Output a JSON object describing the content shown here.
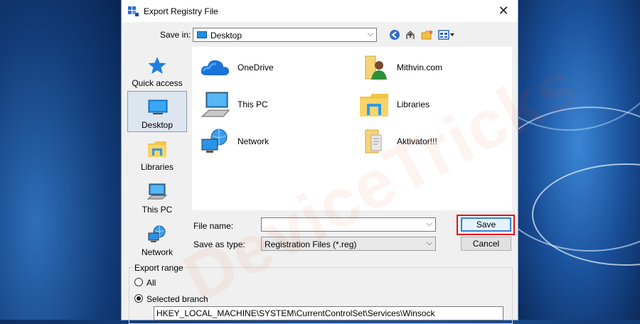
{
  "dialog": {
    "title": "Export Registry File",
    "close_glyph": "✕"
  },
  "save_in": {
    "label": "Save in:",
    "value": "Desktop"
  },
  "places": [
    {
      "label": "Quick access",
      "icon": "star-icon"
    },
    {
      "label": "Desktop",
      "icon": "desktop-icon",
      "selected": true
    },
    {
      "label": "Libraries",
      "icon": "libraries-icon"
    },
    {
      "label": "This PC",
      "icon": "computer-icon"
    },
    {
      "label": "Network",
      "icon": "network-icon"
    }
  ],
  "files": [
    {
      "label": "OneDrive",
      "icon": "cloud-icon"
    },
    {
      "label": "Mithvin.com",
      "icon": "user-folder-icon"
    },
    {
      "label": "This PC",
      "icon": "computer-icon"
    },
    {
      "label": "Libraries",
      "icon": "libraries-icon"
    },
    {
      "label": "Network",
      "icon": "network-icon"
    },
    {
      "label": "Aktivator!!!",
      "icon": "folder-icon"
    }
  ],
  "form": {
    "file_name_label": "File name:",
    "file_name_value": "",
    "save_as_type_label": "Save as type:",
    "save_as_type_value": "Registration Files (*.reg)",
    "save_button": "Save",
    "cancel_button": "Cancel"
  },
  "export_range": {
    "title": "Export range",
    "all_label": "All",
    "selected_label": "Selected branch",
    "selected_checked": true,
    "branch_value": "HKEY_LOCAL_MACHINE\\SYSTEM\\CurrentControlSet\\Services\\Winsock"
  },
  "watermark": "DeviceTricks",
  "colors": {
    "highlight": "#e0141e",
    "accent": "#3c7fd4"
  }
}
